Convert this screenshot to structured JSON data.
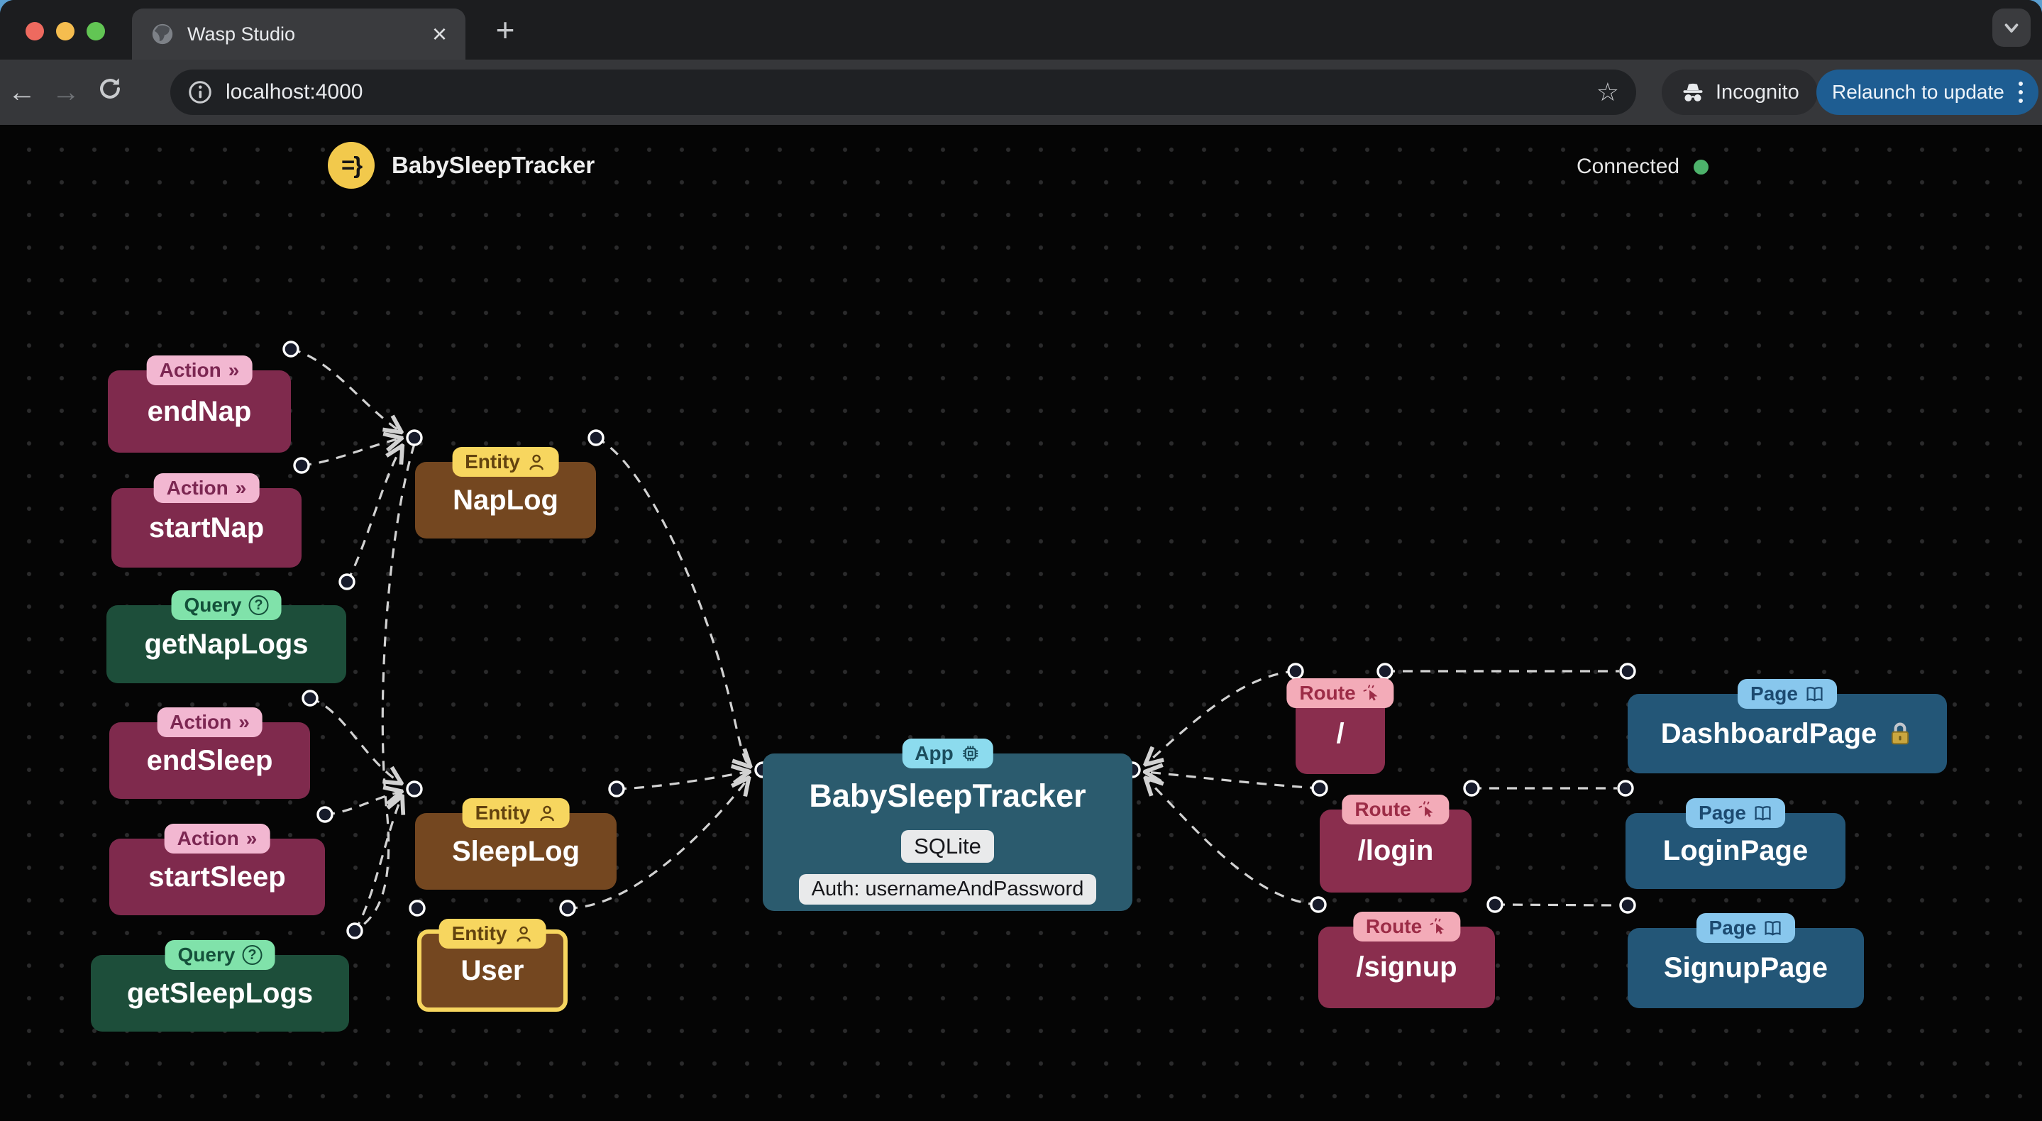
{
  "browser": {
    "tab_title": "Wasp Studio",
    "url": "localhost:4000",
    "incognito_label": "Incognito",
    "relaunch_label": "Relaunch to update",
    "glyphs": {
      "close_tab": "×",
      "new_tab": "+",
      "back": "←",
      "forward": "→",
      "star": "☆"
    }
  },
  "header": {
    "logo_glyph": "=}",
    "app_name": "BabySleepTracker",
    "status": "Connected"
  },
  "icons": {
    "action_chevrons": "»",
    "query_question": "?"
  },
  "canvas": {
    "nodes": {
      "endNap": {
        "badge": "Action",
        "label": "endNap"
      },
      "startNap": {
        "badge": "Action",
        "label": "startNap"
      },
      "getNapLogs": {
        "badge": "Query",
        "label": "getNapLogs"
      },
      "napLog": {
        "badge": "Entity",
        "label": "NapLog"
      },
      "endSleep": {
        "badge": "Action",
        "label": "endSleep"
      },
      "startSleep": {
        "badge": "Action",
        "label": "startSleep"
      },
      "getSleepLogs": {
        "badge": "Query",
        "label": "getSleepLogs"
      },
      "sleepLog": {
        "badge": "Entity",
        "label": "SleepLog"
      },
      "user": {
        "badge": "Entity",
        "label": "User"
      },
      "app": {
        "badge": "App",
        "label": "BabySleepTracker",
        "db": "SQLite",
        "auth": "Auth: usernameAndPassword"
      },
      "routeRoot": {
        "badge": "Route",
        "label": "/"
      },
      "routeLogin": {
        "badge": "Route",
        "label": "/login"
      },
      "routeSignup": {
        "badge": "Route",
        "label": "/signup"
      },
      "dashboardPage": {
        "badge": "Page",
        "label": "DashboardPage"
      },
      "loginPage": {
        "badge": "Page",
        "label": "LoginPage"
      },
      "signupPage": {
        "badge": "Page",
        "label": "SignupPage"
      }
    }
  },
  "colors": {
    "action_fill": "#7f2a4d",
    "action_badge": "#f2b7d1",
    "query_fill": "#1d4e3a",
    "query_badge": "#80e2aa",
    "entity_fill": "#744720",
    "entity_badge": "#f7d65f",
    "route_fill": "#8a2e4e",
    "route_badge": "#f3abb8",
    "page_fill": "#235677",
    "page_badge": "#88c7ed",
    "app_fill": "#2b5b6e",
    "app_badge": "#8cdbee",
    "edge": "#d2d2d2",
    "connected_dot": "#4db26b",
    "relaunch_bg": "#1e5d92",
    "logo_bg": "#f2c94c"
  }
}
